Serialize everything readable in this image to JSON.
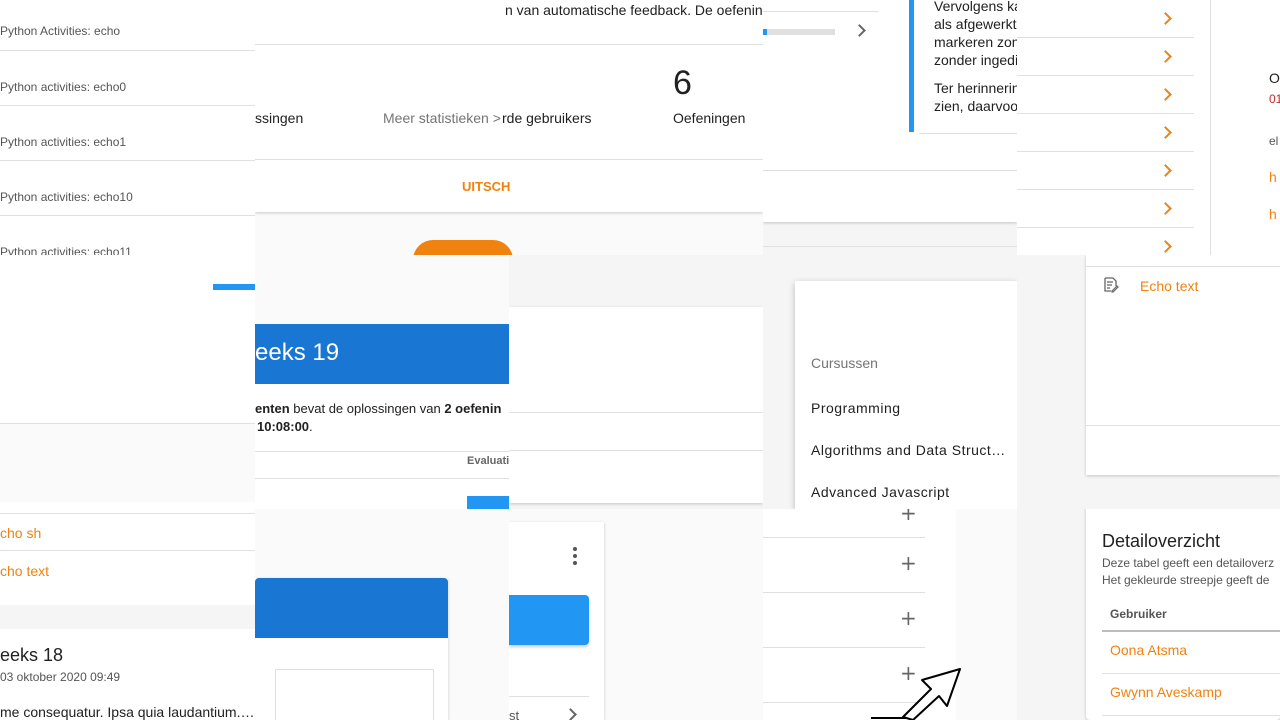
{
  "t1": {
    "items": [
      "Python Activities: echo",
      "Python activities: echo0",
      "Python activities: echo1",
      "Python activities: echo10",
      "Python activities: echo11"
    ]
  },
  "t2": {
    "feedback_text": "n van automatische feedback. De oefenin",
    "stat1_label": "ssingen",
    "more_stats": "Meer statistieken >",
    "stat2_label": "rde gebruikers",
    "stat3_value": "6",
    "stat3_label": "Oefeningen",
    "tab_label": "UITSCH"
  },
  "t4": {
    "line1": "Vervolgens ka",
    "line2": "als afgewerkt-",
    "line3": "markeren zon",
    "line4": "zonder ingedi",
    "line5": "Ter herinnerin",
    "line6": "zien, daarvoo"
  },
  "t5": {
    "header": "ON",
    "date_frag": "01",
    "label": "el",
    "link1": "h",
    "link2": "h"
  },
  "t6": {
    "title": "eeks 19",
    "desc_bold1": "enten",
    "desc_text": " bevat de oplossingen van ",
    "desc_bold2": "2 oefenin",
    "desc_time": "10:08:00",
    "desc_end": ".",
    "col_label": "Evaluati"
  },
  "t7": {
    "section": "Cursussen",
    "courses": [
      "Programming",
      "Algorithms and Data Structures",
      "Advanced Javascript"
    ]
  },
  "t8": {
    "item": "Echo text"
  },
  "t9": {
    "link1": "cho sh",
    "link2": "cho text",
    "title": "eeks 18",
    "date": "03 oktober 2020 09:49",
    "text": "me consequatur. Ipsa quia laudantium. Qu"
  },
  "t11": {
    "list_text": "st"
  },
  "t12": {
    "title": "Detailoverzicht",
    "desc1": "Deze tabel geeft een detailoverz",
    "desc2": "Het gekleurde streepje geeft de",
    "col_user": "Gebruiker",
    "users": [
      "Oona Atsma",
      "Gwynn Aveskamp"
    ]
  },
  "colors": {
    "accent": "#f0820f",
    "primary": "#1976d2",
    "primary_light": "#2196f3"
  }
}
